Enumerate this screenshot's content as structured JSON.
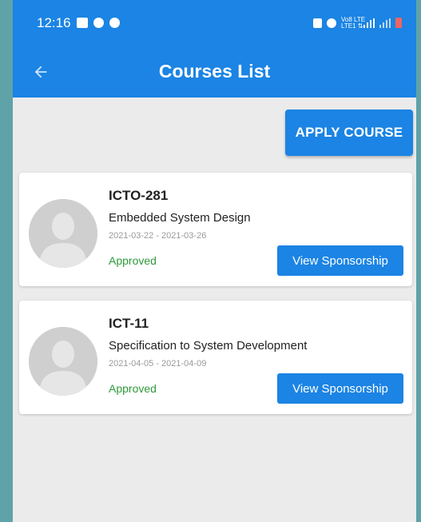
{
  "status_bar": {
    "time": "12:16",
    "left_icons": [
      "image-icon",
      "at-icon",
      "facebook-icon"
    ],
    "right_icons": [
      "lock-icon",
      "alarm-icon",
      "volte-icon",
      "signal-icon",
      "signal-icon",
      "battery-icon"
    ],
    "network_label": "Vo8 LTE\nLTE1 ⇅"
  },
  "toolbar": {
    "back_icon": "arrow-left-icon",
    "title": "Courses List"
  },
  "apply_button": {
    "label": "APPLY COURSE"
  },
  "courses": [
    {
      "code": "ICTO-281",
      "name": "Embedded System Design",
      "dates": "2021-03-22 - 2021-03-26",
      "status": "Approved",
      "action_label": "View Sponsorship"
    },
    {
      "code": "ICT-11",
      "name": "Specification to System Development",
      "dates": "2021-04-05 - 2021-04-09",
      "status": "Approved",
      "action_label": "View Sponsorship"
    }
  ],
  "colors": {
    "primary": "#1b84e4",
    "background": "#ebebeb",
    "approved": "#2e9a3a",
    "frame": "#5fa3a8"
  }
}
